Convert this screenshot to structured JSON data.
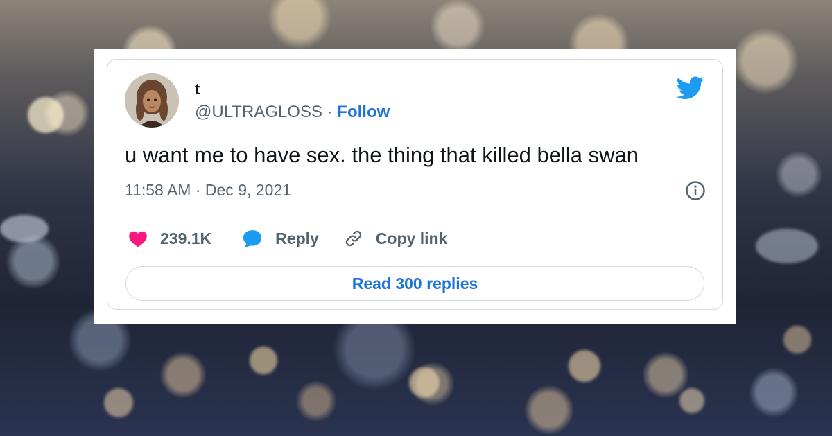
{
  "tweet": {
    "display_name": "t",
    "handle": "@ULTRAGLOSS",
    "separator": " · ",
    "follow_label": "Follow",
    "text": "u want me to have sex. the thing that killed bella swan",
    "timestamp": "11:58 AM · Dec 9, 2021",
    "like_count": "239.1K",
    "reply_label": "Reply",
    "copy_link_label": "Copy link",
    "read_replies_label": "Read 300 replies"
  },
  "icons": {
    "brand": "twitter-bird-icon",
    "like": "heart-icon",
    "reply": "speech-bubble-icon",
    "copy": "link-icon",
    "info": "info-icon"
  },
  "colors": {
    "accent": "#1d74d9",
    "twitter_blue": "#1d9bf0",
    "like_pink": "#f91880",
    "text_primary": "#0f1419",
    "text_secondary": "#536471",
    "border": "#cfd9de"
  }
}
